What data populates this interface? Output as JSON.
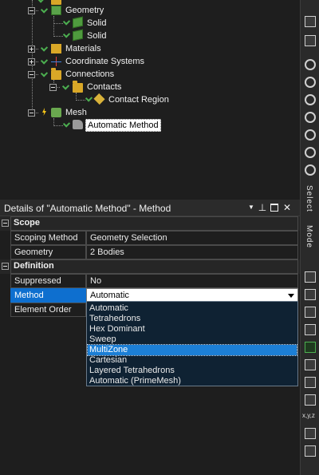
{
  "tree": {
    "items": [
      {
        "label": "Geometry"
      },
      {
        "label": "Solid"
      },
      {
        "label": "Solid"
      },
      {
        "label": "Materials"
      },
      {
        "label": "Coordinate Systems"
      },
      {
        "label": "Connections"
      },
      {
        "label": "Contacts"
      },
      {
        "label": "Contact Region"
      },
      {
        "label": "Mesh"
      },
      {
        "label": "Automatic Method"
      }
    ]
  },
  "toolbar": {
    "select_label": "Select",
    "mode_label": "Mode",
    "xyz_label": "x,y,z"
  },
  "details": {
    "title": "Details of \"Automatic Method\" - Method",
    "pin_icon_glyph": "⊥",
    "close_glyph": "✕",
    "sections": [
      {
        "label": "Scope",
        "rows": [
          {
            "name": "Scoping Method",
            "value": "Geometry Selection"
          },
          {
            "name": "Geometry",
            "value": "2 Bodies"
          }
        ]
      },
      {
        "label": "Definition",
        "rows": [
          {
            "name": "Suppressed",
            "value": "No"
          },
          {
            "name": "Method",
            "value": "Automatic"
          },
          {
            "name": "Element Order",
            "value": ""
          }
        ]
      }
    ]
  },
  "dropdown": {
    "options": [
      "Automatic",
      "Tetrahedrons",
      "Hex Dominant",
      "Sweep",
      "MultiZone",
      "Cartesian",
      "Layered Tetrahedrons",
      "Automatic (PrimeMesh)"
    ],
    "highlighted": "MultiZone"
  }
}
